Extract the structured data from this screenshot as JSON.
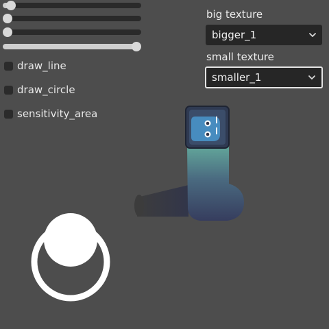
{
  "sliders": [
    {
      "value": 0.06
    },
    {
      "value": 0.0
    },
    {
      "value": 0.0
    },
    {
      "value": 0.985
    }
  ],
  "checkboxes": [
    {
      "label": "draw_line",
      "checked": false
    },
    {
      "label": "draw_circle",
      "checked": false
    },
    {
      "label": "sensitivity_area",
      "checked": false
    }
  ],
  "big_texture": {
    "label": "big texture",
    "selected": "bigger_1"
  },
  "small_texture": {
    "label": "small texture",
    "selected": "smaller_1"
  },
  "colors": {
    "background": "#4d4d4d",
    "godot_blue": "#478cbf",
    "icon_frame": "#2f3a52",
    "trail_dark": "#363d5c",
    "trail_teal": "#5f9e94"
  },
  "icons": {
    "scene_icon": "godot-logo-icon",
    "dropdown": "chevron-down-icon"
  }
}
